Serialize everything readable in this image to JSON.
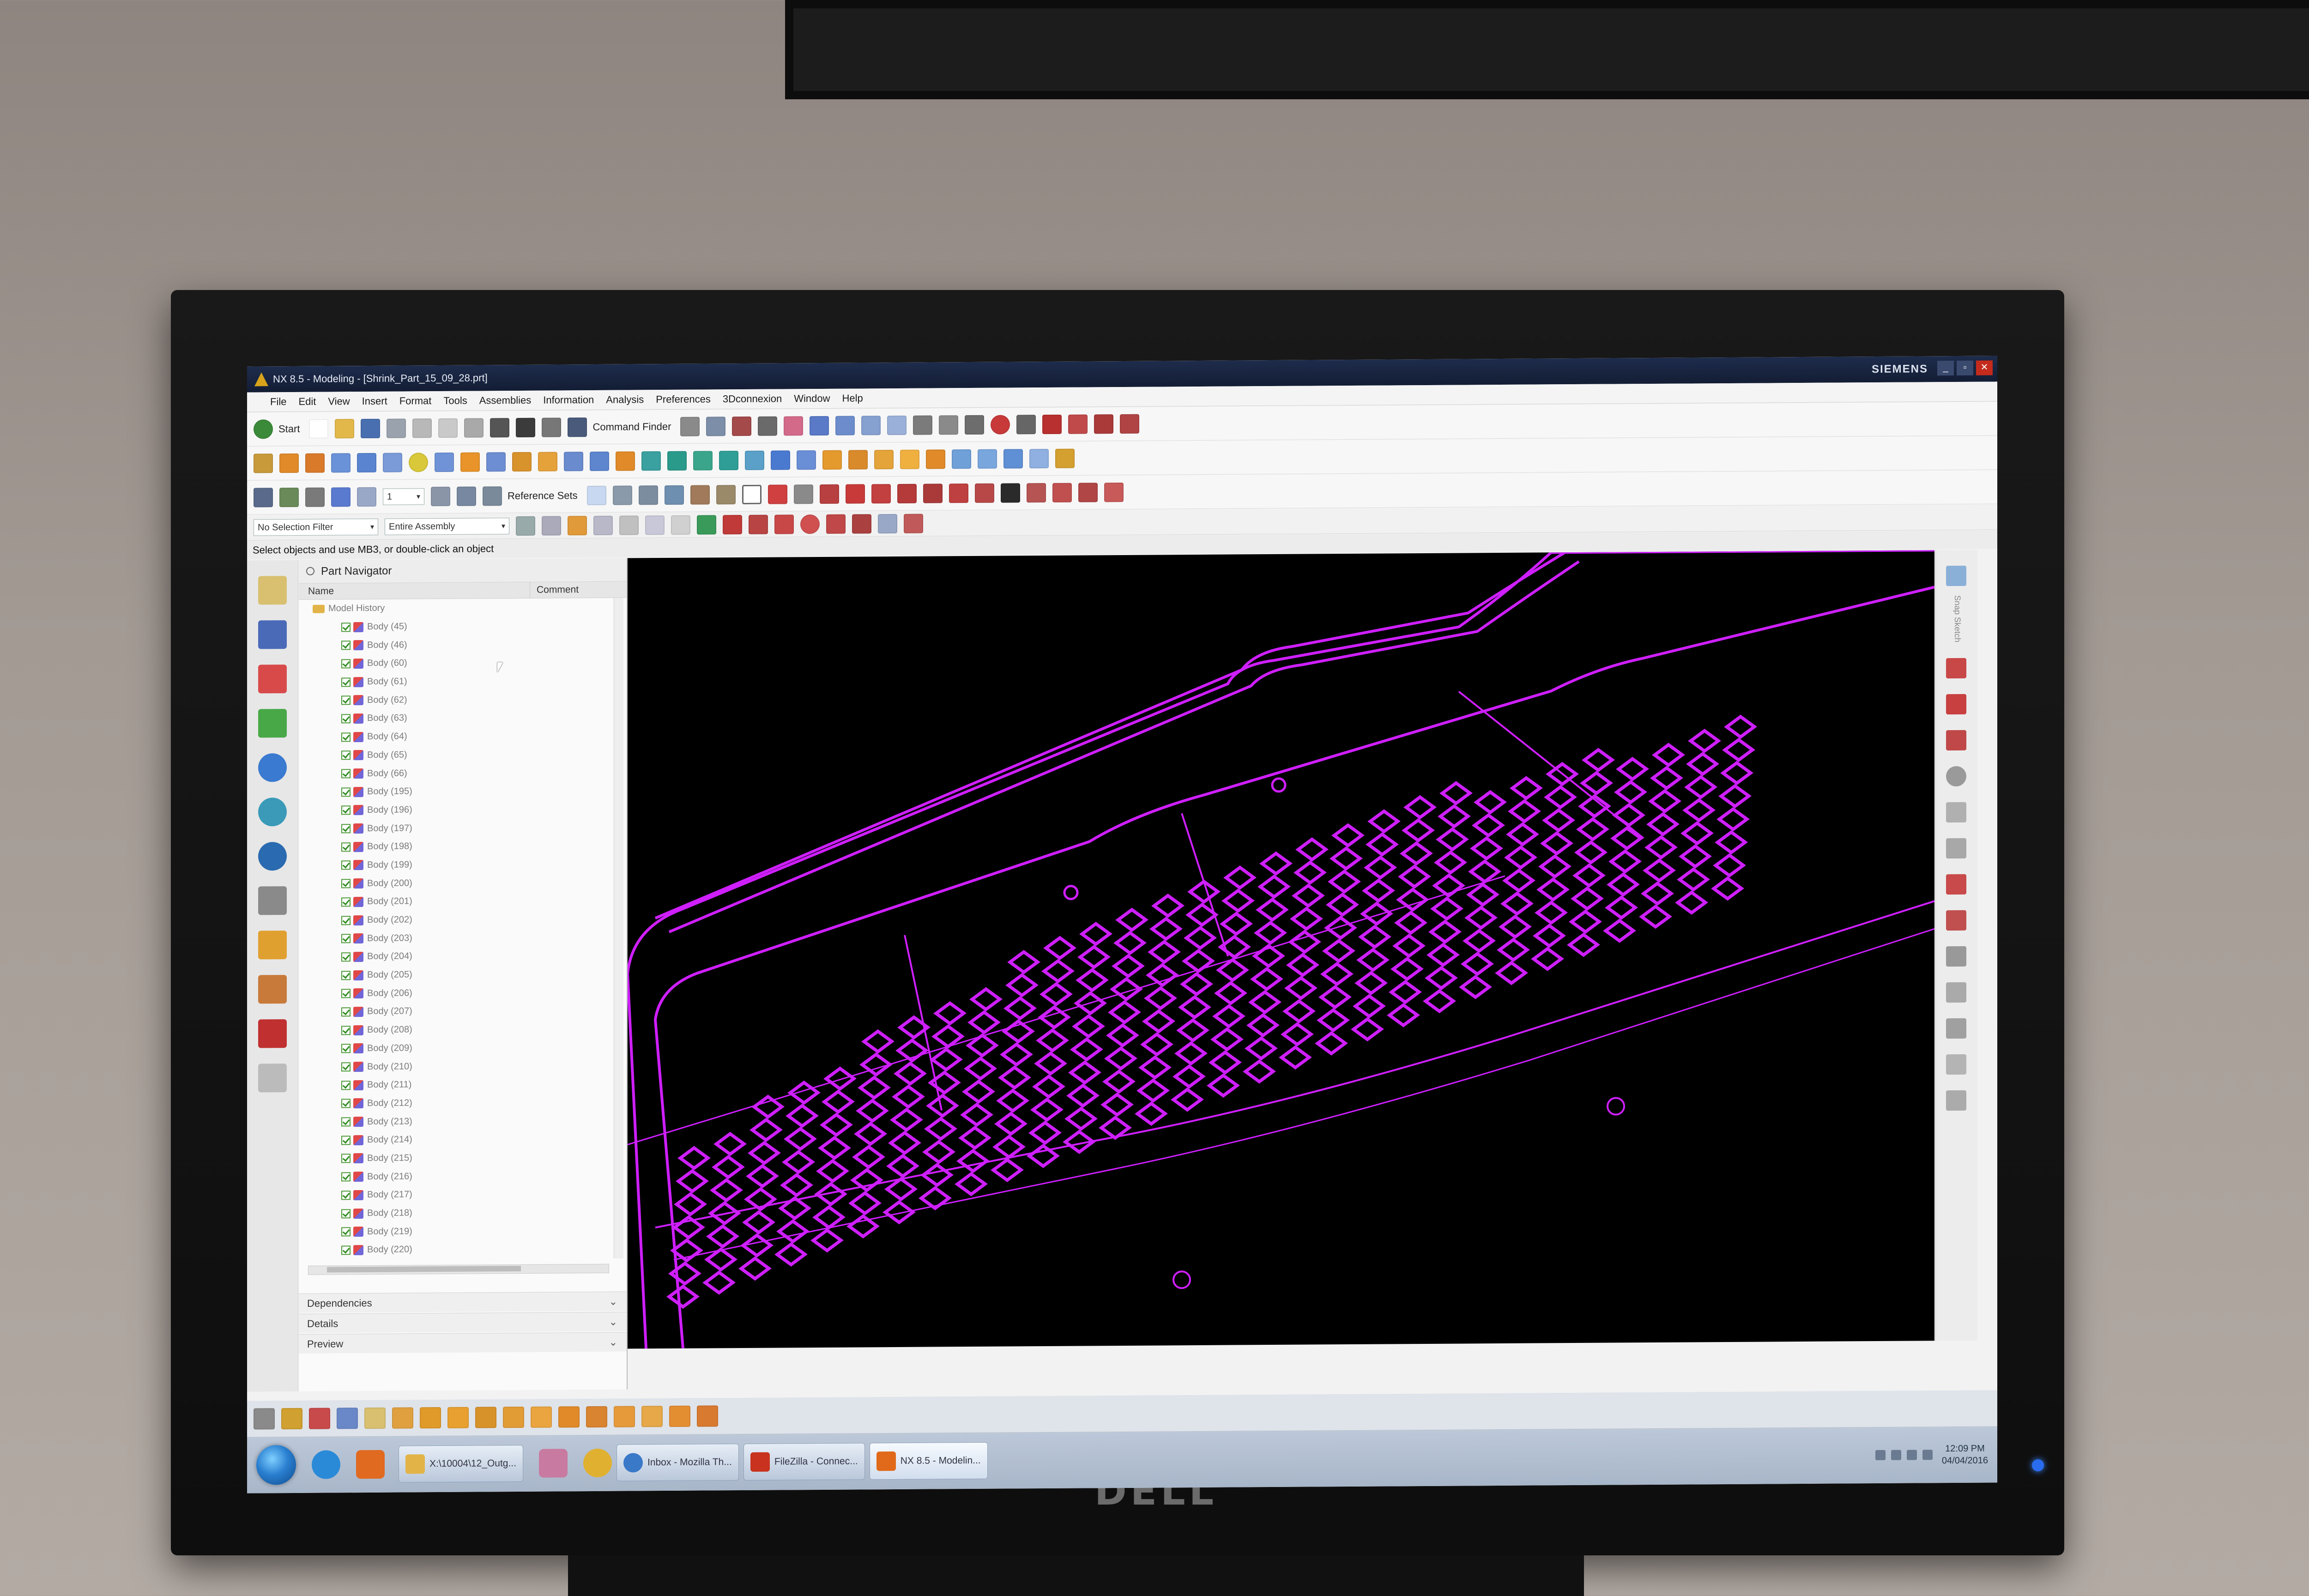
{
  "window": {
    "title": "NX 8.5 - Modeling - [Shrink_Part_15_09_28.prt]",
    "brand": "SIEMENS",
    "controls": [
      "_",
      "▫",
      "✕"
    ]
  },
  "menu": [
    "File",
    "Edit",
    "View",
    "Insert",
    "Format",
    "Tools",
    "Assemblies",
    "Information",
    "Analysis",
    "Preferences",
    "3Dconnexion",
    "Window",
    "Help"
  ],
  "toolbar": {
    "start_label": "Start",
    "command_finder_label": "Command Finder",
    "reference_sets_label": "Reference Sets",
    "layer_value": "1"
  },
  "filters": {
    "selection_filter": "No Selection Filter",
    "scope": "Entire Assembly"
  },
  "cue_line": "Select objects and use MB3, or double-click an object",
  "navigator": {
    "title": "Part Navigator",
    "columns": [
      "Name",
      "Comment"
    ],
    "root": "Model History",
    "items": [
      "Body (45)",
      "Body (46)",
      "Body (60)",
      "Body (61)",
      "Body (62)",
      "Body (63)",
      "Body (64)",
      "Body (65)",
      "Body (66)",
      "Body (195)",
      "Body (196)",
      "Body (197)",
      "Body (198)",
      "Body (199)",
      "Body (200)",
      "Body (201)",
      "Body (202)",
      "Body (203)",
      "Body (204)",
      "Body (205)",
      "Body (206)",
      "Body (207)",
      "Body (208)",
      "Body (209)",
      "Body (210)",
      "Body (211)",
      "Body (212)",
      "Body (213)",
      "Body (214)",
      "Body (215)",
      "Body (216)",
      "Body (217)",
      "Body (218)",
      "Body (219)",
      "Body (220)"
    ],
    "panels": [
      "Dependencies",
      "Details",
      "Preview"
    ]
  },
  "right_bar": {
    "label": "Snap Sketch"
  },
  "taskbar": {
    "tasks": [
      {
        "label": "X:\\10004\\12_Outg...",
        "color": "#e2b448"
      },
      {
        "label": "Inbox - Mozilla Th...",
        "color": "#3a78c8"
      },
      {
        "label": "FileZilla - Connec...",
        "color": "#c8321e"
      },
      {
        "label": "NX 8.5 - Modelin...",
        "color": "#e06a1a",
        "active": true
      }
    ],
    "time": "12:09 PM",
    "date": "04/04/2016"
  },
  "colors": {
    "wireframe": "#cf1fff",
    "graphics_bg": "#000000"
  },
  "monitor_brand": "DELL"
}
